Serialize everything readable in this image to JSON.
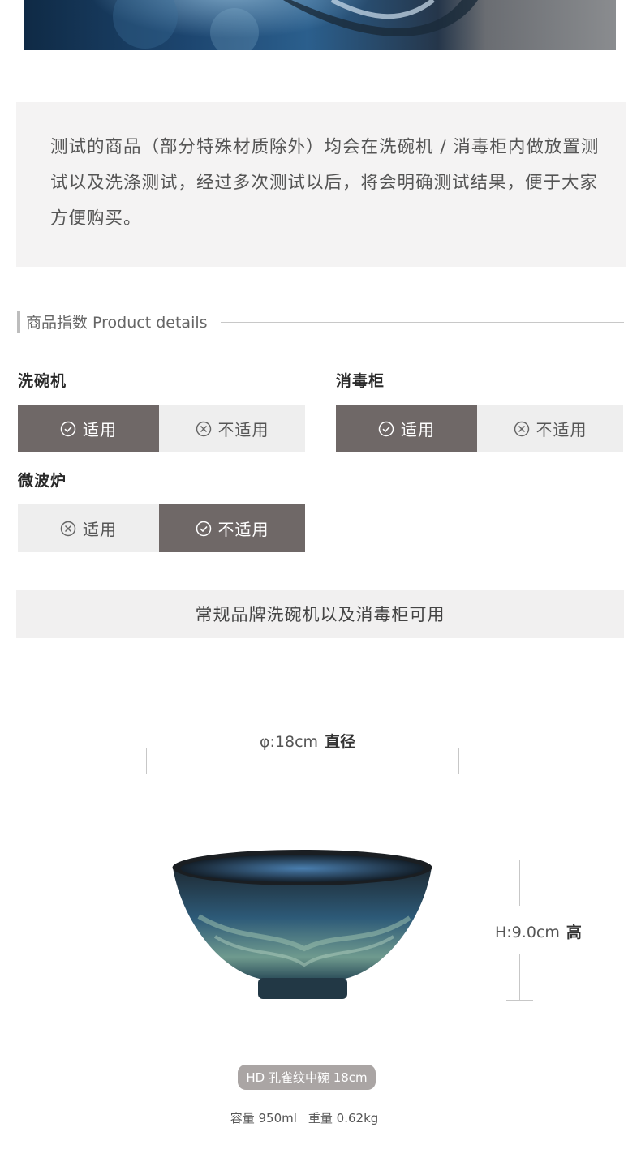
{
  "intro": {
    "text": "测试的商品（部分特殊材质除外）均会在洗碗机 / 消毒柜内做放置测试以及洗涤测试，经过多次测试以后，将会明确测试结果，便于大家方便购买。"
  },
  "section": {
    "title": "商品指数 Product details"
  },
  "categories": [
    {
      "label": "洗碗机",
      "options": [
        "适用",
        "不适用"
      ],
      "selected": "适用"
    },
    {
      "label": "消毒柜",
      "options": [
        "适用",
        "不适用"
      ],
      "selected": "适用"
    },
    {
      "label": "微波炉",
      "options": [
        "适用",
        "不适用"
      ],
      "selected": "不适用"
    }
  ],
  "note": "常规品牌洗碗机以及消毒柜可用",
  "dimensions": {
    "diameter_value": "φ:18cm",
    "diameter_label": "直径",
    "height_value": "H:9.0cm",
    "height_label": "高"
  },
  "product": {
    "name": "HD 孔雀纹中碗 18cm",
    "capacity": "容量 950ml",
    "weight": "重量 0.62kg"
  },
  "icons": {
    "selected": "check-circle-icon",
    "unselected": "x-circle-icon"
  },
  "colors": {
    "selected_bg": "#6f6867",
    "unselected_bg": "#eeeeee",
    "bowl_glaze": "#2d5a78"
  }
}
